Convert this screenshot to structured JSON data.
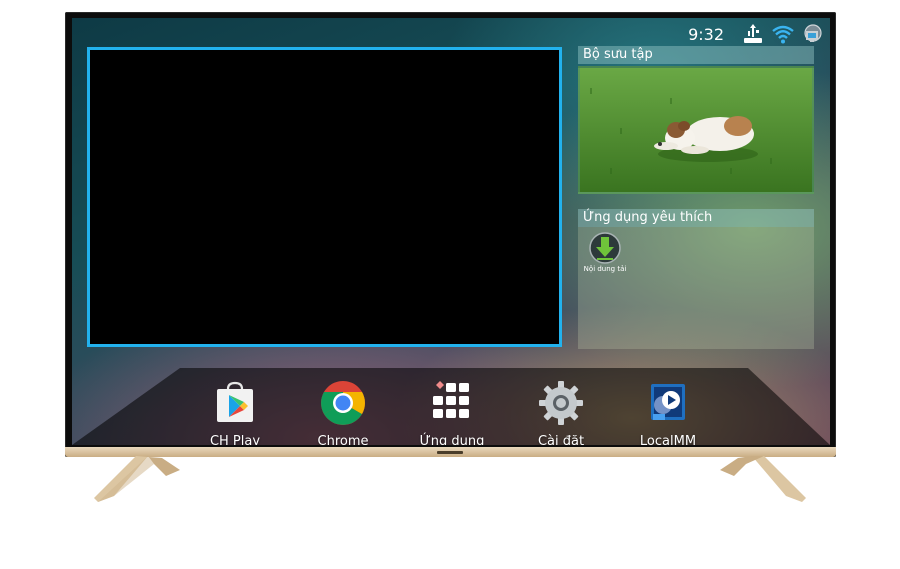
{
  "status_bar": {
    "time": "9:32",
    "icons": [
      "usb-icon",
      "wifi-icon",
      "network-icon"
    ]
  },
  "gallery": {
    "title": "Bộ sưu tập",
    "thumbnail_icon": "dog-on-grass-photo"
  },
  "favorites": {
    "title": "Ứng dụng yêu thích",
    "apps": [
      {
        "label": "Nội dung tải",
        "icon": "download-icon"
      }
    ]
  },
  "dock": {
    "apps": [
      {
        "label": "CH Play",
        "icon": "play-store-icon"
      },
      {
        "label": "Chrome",
        "icon": "chrome-icon"
      },
      {
        "label": "Ứng dụng",
        "icon": "app-grid-icon"
      },
      {
        "label": "Cài đặt",
        "icon": "settings-gear-icon"
      },
      {
        "label": "LocalMM",
        "icon": "local-media-icon"
      }
    ]
  },
  "colors": {
    "video_border": "#22b2ee",
    "bezel": "#0c0c0c",
    "stand_gold": "#d9c29f"
  }
}
